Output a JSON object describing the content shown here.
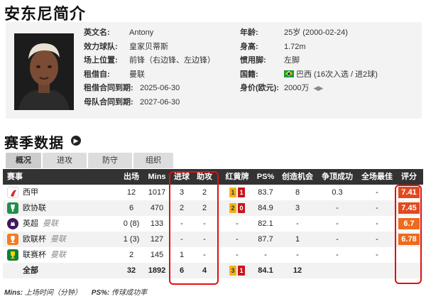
{
  "page_title": "安东尼简介",
  "profile": {
    "left_rows": [
      {
        "key": "英文名:",
        "value": "Antony"
      },
      {
        "key": "效力球队:",
        "value": "皇家贝蒂斯"
      },
      {
        "key": "场上位置:",
        "value": "前锋（右边锋、左边锋）"
      },
      {
        "key": "租借自:",
        "value": "曼联"
      },
      {
        "key": "租借合同到期:",
        "value": "2025-06-30"
      },
      {
        "key": "母队合同到期:",
        "value": "2027-06-30"
      }
    ],
    "right_rows": [
      {
        "key": "年龄:",
        "value": "25岁 (2000-02-24)"
      },
      {
        "key": "身高:",
        "value": "1.72m"
      },
      {
        "key": "惯用脚:",
        "value": "左脚"
      },
      {
        "key": "国籍:",
        "value": "巴西 (16次入选 / 进2球)"
      },
      {
        "key": "身价(欧元):",
        "value": "2000万"
      }
    ]
  },
  "section_title": "赛季数据",
  "tabs": [
    "概况",
    "进攻",
    "防守",
    "组织"
  ],
  "table": {
    "headers": [
      "赛事",
      "出场",
      "Mins",
      "进球",
      "助攻",
      "红黄牌",
      "PS%",
      "创造机会",
      "争顶成功",
      "全场最佳",
      "评分"
    ],
    "rows": [
      {
        "league": "西甲",
        "loan": "",
        "apps": "12",
        "mins": "1017",
        "goals": "3",
        "assists": "2",
        "yellow": "1",
        "red": "1",
        "ps": "83.7",
        "chances": "8",
        "aerial": "0.3",
        "motm": "-",
        "rating": "7.41"
      },
      {
        "league": "欧协联",
        "loan": "",
        "apps": "6",
        "mins": "470",
        "goals": "2",
        "assists": "2",
        "yellow": "2",
        "red": "0",
        "ps": "84.9",
        "chances": "3",
        "aerial": "-",
        "motm": "-",
        "rating": "7.45"
      },
      {
        "league": "英超",
        "loan": "曼联",
        "apps": "0 (8)",
        "mins": "133",
        "goals": "-",
        "assists": "-",
        "yellow": "",
        "red": "",
        "ps": "82.1",
        "chances": "-",
        "aerial": "-",
        "motm": "-",
        "rating": "6.7"
      },
      {
        "league": "欧联杯",
        "loan": "曼联",
        "apps": "1 (3)",
        "mins": "127",
        "goals": "-",
        "assists": "-",
        "yellow": "",
        "red": "",
        "ps": "87.7",
        "chances": "1",
        "aerial": "-",
        "motm": "-",
        "rating": "6.78"
      },
      {
        "league": "联赛杯",
        "loan": "曼联",
        "apps": "2",
        "mins": "145",
        "goals": "1",
        "assists": "-",
        "yellow": "",
        "red": "",
        "ps": "-",
        "chances": "-",
        "aerial": "-",
        "motm": "-",
        "rating": ""
      },
      {
        "league": "全部",
        "loan": "",
        "apps": "32",
        "mins": "1892",
        "goals": "6",
        "assists": "4",
        "yellow": "3",
        "red": "1",
        "ps": "84.1",
        "chances": "12",
        "aerial": "",
        "motm": "",
        "rating": ""
      }
    ]
  },
  "footnote": {
    "mins_key": "Mins:",
    "mins_val": "上场时间（分钟）",
    "ps_key": "PS%:",
    "ps_val": "传球成功率"
  },
  "colors": {
    "header_bg": "#333333",
    "highlight_box": "#e01010",
    "rating_high": "#e04a1f",
    "rating_mid": "#ee6a1c",
    "yellow_card": "#f2b21c",
    "red_card": "#c8161d"
  },
  "icons": [
    "laliga-icon",
    "conference-league-icon",
    "premier-league-icon",
    "europa-league-icon",
    "league-cup-icon",
    "brazil-flag-icon",
    "value-arrows-icon"
  ]
}
